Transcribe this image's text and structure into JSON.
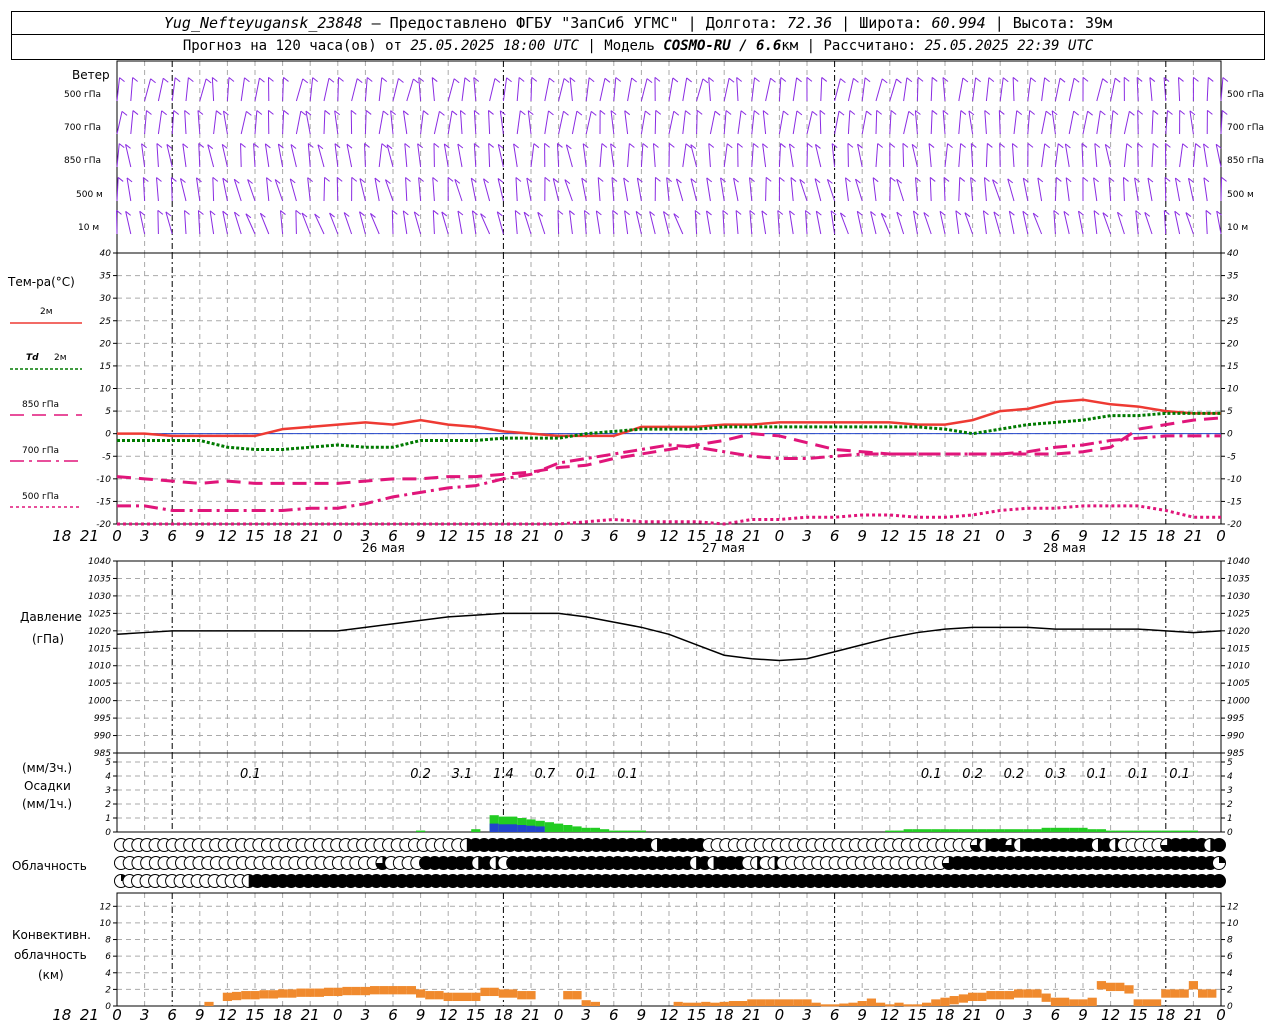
{
  "header": {
    "station": "Yug_Nefteyugansk_23848",
    "provider": " – Предоставлено ФГБУ \"ЗапСиб УГМС\" | Долгота: ",
    "lon": "72.36",
    "lat_label": " | Широта: ",
    "lat": "60.994",
    "alt_label": " | Высота: 39м",
    "forecast_label": "Прогноз на 120 часа(ов) от ",
    "forecast_time": "25.05.2025 18:00 UTC",
    "model_label": " | Модель ",
    "model": "COSMO-RU / 6.6",
    "model_unit": "км",
    "computed_label": " | Рассчитано: ",
    "computed_time": "25.05.2025 22:39 UTC"
  },
  "labels": {
    "wind": "Ветер",
    "wind_levels": [
      "500 гПа",
      "700 гПа",
      "850 гПа",
      "500 м",
      "10   м"
    ],
    "temp": "Тем-ра(°C)",
    "t2m": "2м",
    "td_a": "Td",
    "td_b": "2м",
    "t850": "850 гПа",
    "t700": "700 гПа",
    "t500": "500 гПа",
    "pressure": "Давление",
    "pressure_unit": "(гПа)",
    "precip_3h": "(мм/3ч.)",
    "precip": "Осадки",
    "precip_1h": "(мм/1ч.)",
    "clouds": "Облачность",
    "conv1": "Конвективн.",
    "conv2": "облачность",
    "conv3": "(км)"
  },
  "colors": {
    "t2m": "#ee3a33",
    "td2m": "#007a00",
    "levels": "#e0157a",
    "wind": "#8a2be2",
    "precip_green": "#22cc22",
    "precip_blue": "#2244cc",
    "convective": "#f08a2e"
  },
  "chart_data": [
    {
      "type": "line",
      "panel": "wind",
      "levels": [
        "500 гПа",
        "700 гПа",
        "850 гПа",
        "500 м",
        "10 м"
      ],
      "hours": [
        0,
        120
      ],
      "note": "wind barbs, hourly"
    },
    {
      "type": "line",
      "panel": "temperature",
      "ylim": [
        -20,
        40
      ],
      "yticks": [
        -20,
        -15,
        -10,
        -5,
        0,
        5,
        10,
        15,
        20,
        25,
        30,
        35,
        40
      ],
      "x": [
        0,
        3,
        6,
        9,
        12,
        15,
        18,
        21,
        24,
        27,
        30,
        33,
        36,
        39,
        42,
        45,
        48,
        51,
        54,
        57,
        60,
        63,
        66,
        69,
        72,
        75,
        78,
        81,
        84,
        87,
        90,
        93,
        96,
        99,
        102,
        105,
        108,
        111,
        114,
        117,
        120
      ],
      "series": [
        {
          "name": "2м",
          "values": [
            0,
            0,
            -0.5,
            -0.5,
            -0.5,
            -0.5,
            1,
            1.5,
            2,
            2.5,
            2,
            3,
            2,
            1.5,
            0.5,
            0,
            -0.5,
            -0.5,
            -0.5,
            1.5,
            1.5,
            1.5,
            2,
            2,
            2.5,
            2.5,
            2.5,
            2.5,
            2.5,
            2,
            2,
            3,
            5,
            5.5,
            7,
            7.5,
            6.5,
            6,
            5,
            4.5,
            4.5
          ]
        },
        {
          "name": "Td 2м",
          "values": [
            -1.5,
            -1.5,
            -1.5,
            -1.5,
            -3,
            -3.5,
            -3.5,
            -3,
            -2.5,
            -3,
            -3,
            -1.5,
            -1.5,
            -1.5,
            -1,
            -1,
            -1,
            0,
            0.5,
            1,
            1,
            1,
            1.5,
            1.5,
            1.5,
            1.5,
            1.5,
            1.5,
            1.5,
            1.5,
            1,
            0,
            1,
            2,
            2.5,
            3,
            4,
            4,
            4.5,
            4.5,
            4.5
          ]
        },
        {
          "name": "850 гПа",
          "values": [
            -9.5,
            -10,
            -10.5,
            -11,
            -10.5,
            -11,
            -11,
            -11,
            -11,
            -10.5,
            -10,
            -10,
            -9.5,
            -9.5,
            -9,
            -8.5,
            -7.5,
            -7,
            -5.5,
            -4.5,
            -3.5,
            -2.5,
            -1.5,
            0,
            -0.5,
            -2,
            -3.5,
            -4,
            -4.5,
            -4.5,
            -4.5,
            -4.5,
            -4.5,
            -4.5,
            -4.5,
            -4,
            -3,
            1,
            2,
            3,
            3.5
          ]
        },
        {
          "name": "700 гПа",
          "values": [
            -16,
            -16,
            -17,
            -17,
            -17,
            -17,
            -17,
            -16.5,
            -16.5,
            -15.5,
            -14,
            -13,
            -12,
            -11.5,
            -10,
            -9,
            -6.5,
            -5.5,
            -4.5,
            -3.5,
            -2.5,
            -3,
            -4,
            -5,
            -5.5,
            -5.5,
            -5,
            -4.5,
            -4.5,
            -4.5,
            -4.5,
            -4.5,
            -4.5,
            -4,
            -3,
            -2.5,
            -1.5,
            -1,
            -0.5,
            -0.5,
            -0.5
          ]
        },
        {
          "name": "500 гПа",
          "values": [
            -21,
            -21,
            -21,
            -21,
            -21,
            -21,
            -21,
            -21,
            -21,
            -21,
            -21,
            -21,
            -21,
            -21,
            -21,
            -21,
            -20.5,
            -19.5,
            -19,
            -19.5,
            -19.5,
            -19.5,
            -20,
            -19,
            -19,
            -18.5,
            -18.5,
            -18,
            -18,
            -18.5,
            -18.5,
            -18,
            -17,
            -16.5,
            -16.5,
            -16,
            -16,
            -16,
            -17,
            -18.5,
            -18.5
          ]
        }
      ]
    },
    {
      "type": "line",
      "panel": "pressure",
      "ylim": [
        985,
        1040
      ],
      "yticks": [
        985,
        990,
        995,
        1000,
        1005,
        1010,
        1015,
        1020,
        1025,
        1030,
        1035,
        1040
      ],
      "x": [
        0,
        3,
        6,
        9,
        12,
        15,
        18,
        21,
        24,
        27,
        30,
        33,
        36,
        39,
        42,
        45,
        48,
        51,
        54,
        57,
        60,
        63,
        66,
        69,
        72,
        75,
        78,
        81,
        84,
        87,
        90,
        93,
        96,
        99,
        102,
        105,
        108,
        111,
        114,
        117,
        120
      ],
      "series": [
        {
          "name": "",
          "values": [
            1019,
            1019.5,
            1020,
            1020,
            1020,
            1020,
            1020,
            1020,
            1020,
            1021,
            1022,
            1023,
            1024,
            1024.5,
            1025,
            1025,
            1025,
            1024,
            1022.5,
            1021,
            1019,
            1016,
            1013,
            1012,
            1011.5,
            1012,
            1014,
            1016,
            1018,
            1019.5,
            1020.5,
            1021,
            1021,
            1021,
            1020.5,
            1020.5,
            1020.5,
            1020.5,
            1020,
            1019.5,
            1020
          ]
        }
      ]
    },
    {
      "type": "bar",
      "panel": "precipitation",
      "ylim": [
        0,
        5
      ],
      "labels_3h": [
        "0.1",
        "0.2",
        "3.1",
        "1.4",
        "0.7",
        "0.1",
        "0.1",
        "0.1",
        "0.2",
        "0.2",
        "0.3",
        "0.1",
        "0.1",
        "0.1"
      ],
      "x": [
        33,
        39,
        41,
        42,
        43,
        44,
        45,
        46,
        47,
        48,
        49,
        50,
        51,
        52,
        53,
        54,
        55,
        56,
        57,
        84,
        85,
        86,
        87,
        88,
        89,
        90,
        91,
        92,
        93,
        94,
        95,
        96,
        97,
        98,
        99,
        100,
        101,
        102,
        103,
        104,
        105,
        106,
        107,
        108,
        109,
        110,
        111,
        112,
        113,
        114,
        115,
        116,
        117
      ],
      "values": [
        0.1,
        0.2,
        1.2,
        1.1,
        1.1,
        1.0,
        0.9,
        0.8,
        0.7,
        0.6,
        0.5,
        0.4,
        0.3,
        0.3,
        0.2,
        0.1,
        0.1,
        0.1,
        0.1,
        0.1,
        0.1,
        0.2,
        0.2,
        0.2,
        0.2,
        0.2,
        0.2,
        0.2,
        0.2,
        0.2,
        0.2,
        0.2,
        0.2,
        0.2,
        0.2,
        0.2,
        0.3,
        0.3,
        0.3,
        0.3,
        0.3,
        0.2,
        0.2,
        0.1,
        0.1,
        0.1,
        0.1,
        0.1,
        0.1,
        0.1,
        0.1,
        0.1,
        0.1
      ]
    },
    {
      "type": "heatmap",
      "panel": "cloudiness",
      "rows": [
        [
          0,
          0,
          0,
          0,
          0,
          0,
          0,
          0,
          0,
          0,
          0,
          0,
          0,
          0,
          0,
          0,
          0,
          0,
          0,
          0,
          0,
          0,
          0,
          0,
          0,
          0,
          0,
          0,
          0,
          0,
          0,
          0,
          0,
          0,
          0,
          0,
          0,
          0,
          0,
          0,
          2,
          4,
          4,
          4,
          4,
          4,
          4,
          4,
          4,
          4,
          4,
          4,
          4,
          4,
          4,
          4,
          4,
          4,
          4,
          4,
          4,
          4,
          2,
          4,
          4,
          4,
          4,
          4,
          0,
          0,
          0,
          0,
          0,
          0,
          0,
          0,
          0,
          0,
          0,
          0,
          0,
          0,
          0,
          0,
          0,
          0,
          0,
          0,
          0,
          0,
          0,
          0,
          0,
          0,
          0,
          0,
          0,
          0,
          0,
          3,
          2,
          4,
          4,
          3,
          2,
          4,
          4,
          4,
          4,
          4,
          4,
          4,
          4,
          2,
          4,
          2,
          0,
          0,
          0,
          0,
          0,
          3,
          4,
          4,
          4,
          4,
          2,
          4
        ],
        [
          0,
          0,
          0,
          0,
          0,
          0,
          0,
          0,
          0,
          0,
          0,
          0,
          0,
          0,
          0,
          0,
          0,
          0,
          0,
          0,
          0,
          0,
          0,
          0,
          0,
          0,
          0,
          0,
          0,
          0,
          3,
          0,
          0,
          0,
          0,
          4,
          4,
          4,
          4,
          4,
          4,
          2,
          4,
          2,
          0,
          4,
          4,
          4,
          4,
          4,
          4,
          4,
          4,
          4,
          4,
          4,
          4,
          4,
          4,
          4,
          4,
          4,
          4,
          4,
          4,
          4,
          2,
          4,
          2,
          4,
          4,
          4,
          0,
          2,
          0,
          2,
          0,
          0,
          0,
          0,
          0,
          0,
          0,
          0,
          0,
          0,
          0,
          0,
          0,
          0,
          0,
          0,
          0,
          0,
          0,
          3,
          4,
          4,
          4,
          4,
          4,
          4,
          4,
          4,
          4,
          4,
          4,
          4,
          4,
          4,
          4,
          4,
          4,
          4,
          4,
          4,
          4,
          4,
          4,
          4,
          4,
          4,
          4,
          4,
          4,
          4,
          1
        ],
        [
          1,
          0,
          0,
          0,
          0,
          0,
          0,
          0,
          0,
          0,
          0,
          0,
          0,
          0,
          0,
          2,
          4,
          4,
          4,
          4,
          4,
          4,
          4,
          4,
          4,
          4,
          4,
          4,
          4,
          4,
          4,
          4,
          4,
          4,
          4,
          4,
          4,
          4,
          4,
          4,
          4,
          4,
          4,
          4,
          4,
          4,
          4,
          4,
          4,
          4,
          4,
          4,
          4,
          4,
          4,
          4,
          4,
          4,
          4,
          4,
          4,
          4,
          4,
          4,
          4,
          4,
          4,
          4,
          4,
          4,
          4,
          4,
          4,
          4,
          4,
          4,
          4,
          4,
          4,
          4,
          4,
          4,
          4,
          4,
          4,
          4,
          4,
          4,
          4,
          4,
          4,
          4,
          4,
          4,
          4,
          4,
          4,
          4,
          4,
          4,
          4,
          4,
          4,
          4,
          4,
          4,
          4,
          4,
          4,
          4,
          4,
          4,
          4,
          4,
          4,
          4,
          4,
          4,
          4,
          4,
          4,
          4,
          4,
          4,
          4,
          4,
          4,
          4,
          4,
          4
        ]
      ]
    },
    {
      "type": "bar",
      "panel": "convective",
      "ylim": [
        0,
        13
      ],
      "yticks": [
        0,
        2,
        4,
        6,
        8,
        10,
        12
      ],
      "x": [
        10,
        12,
        13,
        14,
        15,
        16,
        17,
        18,
        19,
        20,
        21,
        22,
        23,
        24,
        25,
        26,
        27,
        28,
        29,
        30,
        31,
        32,
        33,
        34,
        35,
        36,
        37,
        38,
        39,
        40,
        41,
        42,
        43,
        44,
        45,
        49,
        50,
        51,
        52,
        61,
        62,
        63,
        64,
        65,
        66,
        67,
        68,
        69,
        70,
        71,
        72,
        73,
        74,
        75,
        76,
        77,
        78,
        79,
        80,
        81,
        82,
        83,
        84,
        85,
        86,
        87,
        88,
        89,
        90,
        91,
        92,
        93,
        94,
        95,
        96,
        97,
        98,
        99,
        100,
        101,
        102,
        103,
        104,
        105,
        106,
        107,
        108,
        109,
        110,
        111,
        112,
        113,
        114,
        115,
        116,
        117,
        118,
        119
      ],
      "values": [
        0.5,
        1.6,
        1.7,
        1.8,
        1.8,
        1.9,
        1.9,
        2.0,
        2.0,
        2.1,
        2.1,
        2.1,
        2.2,
        2.2,
        2.3,
        2.3,
        2.3,
        2.4,
        2.4,
        2.4,
        2.4,
        2.4,
        2.0,
        1.8,
        1.8,
        1.6,
        1.6,
        1.6,
        1.6,
        2.2,
        2.2,
        2.0,
        2.0,
        1.8,
        1.8,
        1.8,
        1.8,
        0.7,
        0.5,
        0.5,
        0.4,
        0.4,
        0.5,
        0.4,
        0.5,
        0.6,
        0.6,
        0.8,
        0.8,
        0.8,
        0.8,
        0.8,
        0.8,
        0.8,
        0.4,
        0.2,
        0.2,
        0.3,
        0.4,
        0.6,
        0.9,
        0.4,
        0.2,
        0.4,
        0.2,
        0.2,
        0.4,
        0.8,
        1.0,
        1.2,
        1.4,
        1.6,
        1.6,
        1.8,
        1.8,
        1.8,
        2.0,
        2.0,
        2.0,
        1.5,
        1.0,
        1.0,
        0.8,
        0.8,
        1.0,
        3.0,
        2.8,
        2.8,
        2.5,
        0.8,
        0.8,
        0.8,
        2.0,
        2.0,
        2.0,
        3.0,
        2.0,
        2.0
      ]
    }
  ],
  "xaxis": {
    "hour_labels": [
      "18",
      "21",
      "0",
      "3",
      "6",
      "9",
      "12",
      "15",
      "18",
      "21",
      "0",
      "3",
      "6",
      "9",
      "12",
      "15",
      "18",
      "21",
      "0",
      "3",
      "6",
      "9",
      "12",
      "15",
      "18",
      "21",
      "0",
      "3",
      "6",
      "9",
      "12",
      "15",
      "18",
      "21",
      "0",
      "3",
      "6",
      "9",
      "12",
      "15",
      "18",
      "21",
      "0"
    ],
    "day1": "26 мая",
    "day2": "27 мая",
    "day3": "28 мая"
  }
}
